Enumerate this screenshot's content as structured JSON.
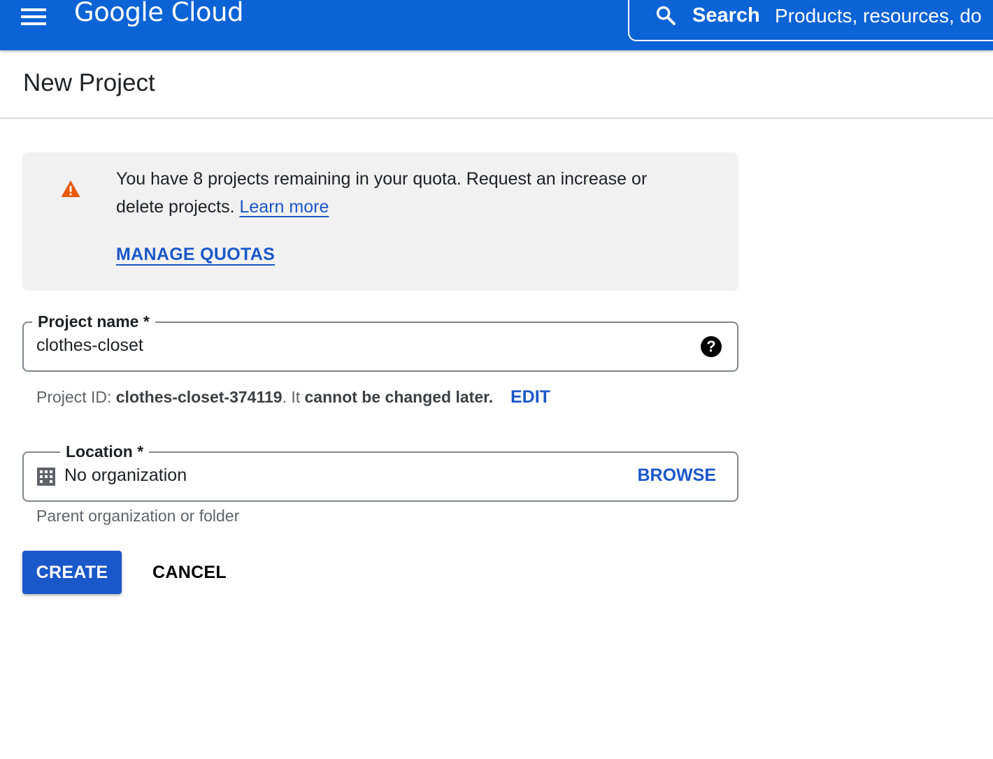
{
  "header": {
    "brand": "Google Cloud",
    "search_label": "Search",
    "search_placeholder": "Products, resources, do"
  },
  "page": {
    "title": "New Project"
  },
  "notice": {
    "message": "You have 8 projects remaining in your quota. Request an increase or delete projects.",
    "learn_more": "Learn more",
    "manage_quotas": "MANAGE QUOTAS",
    "icon": "warning-icon",
    "icon_color": "#e8590c"
  },
  "project_name": {
    "label": "Project name *",
    "value": "clothes-closet",
    "help_icon": "?"
  },
  "project_id": {
    "prefix": "Project ID: ",
    "id": "clothes-closet-374119",
    "middle": ". It ",
    "emphasis": "cannot be changed later.",
    "edit_label": "EDIT"
  },
  "location": {
    "label": "Location *",
    "value": "No organization",
    "browse_label": "BROWSE",
    "hint": "Parent organization or folder"
  },
  "actions": {
    "create_label": "CREATE",
    "cancel_label": "CANCEL"
  },
  "colors": {
    "topbar": "#0b63d6",
    "accent": "#1a57c9",
    "notice_bg": "#f1f1f1"
  }
}
